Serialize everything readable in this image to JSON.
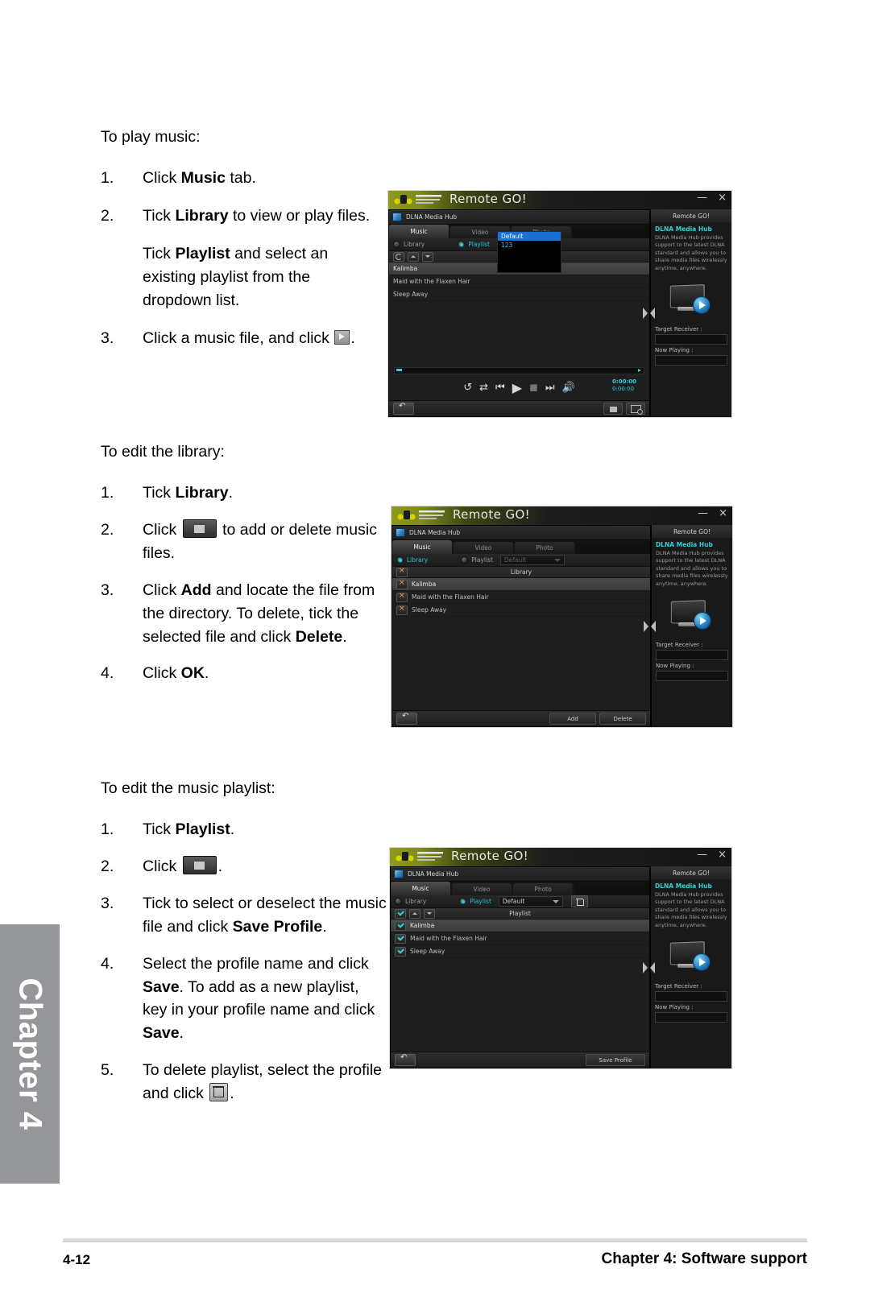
{
  "document": {
    "chapter_tab": "Chapter 4",
    "footer_page": "4-12",
    "footer_title": "Chapter 4: Software support"
  },
  "sections": [
    {
      "heading": "To play music:",
      "steps": [
        {
          "num": "1.",
          "text_pre": "Click ",
          "bold": "Music",
          "text_post": " tab."
        },
        {
          "num": "2.",
          "text_pre": "Tick ",
          "bold": "Library",
          "text_post": " to view or play files."
        },
        {
          "num": "",
          "text_pre": "Tick ",
          "bold": "Playlist",
          "text_post": " and select an existing playlist from the dropdown list."
        },
        {
          "num": "3.",
          "text_pre": "Click a music file, and click ",
          "bold": "",
          "text_post": "."
        }
      ]
    },
    {
      "heading": "To edit the library:",
      "steps": [
        {
          "num": "1.",
          "text_pre": "Tick ",
          "bold": "Library",
          "text_post": "."
        },
        {
          "num": "2.",
          "text_pre": "Click ",
          "bold": "",
          "text_post": " to add or delete music files."
        },
        {
          "num": "3.",
          "text_pre": "Click ",
          "bold": "Add",
          "text_post": " and locate the file from the directory. To delete, tick the selected file and click ",
          "bold2": "Delete",
          "text_end": "."
        },
        {
          "num": "4.",
          "text_pre": "Click ",
          "bold": "OK",
          "text_post": "."
        }
      ]
    },
    {
      "heading": "To edit the music playlist:",
      "steps": [
        {
          "num": "1.",
          "text_pre": "Tick ",
          "bold": "Playlist",
          "text_post": "."
        },
        {
          "num": "2.",
          "text_pre": "Click ",
          "bold": "",
          "text_post": "."
        },
        {
          "num": "3.",
          "text_pre": "Tick to select or deselect the music file and click ",
          "bold": "Save Profile",
          "text_post": "."
        },
        {
          "num": "4.",
          "text_pre": "Select the profile name and click ",
          "bold": "Save",
          "text_post": ". To add as a new playlist, key in your profile name and click ",
          "bold2": "Save",
          "text_end": "."
        },
        {
          "num": "5.",
          "text_pre": "To delete playlist, select the profile and click ",
          "bold": "",
          "text_post": "."
        }
      ]
    }
  ],
  "app": {
    "title": "Remote GO!",
    "hub_label": "DLNA Media Hub",
    "tabs": [
      "Music",
      "Video",
      "Photo"
    ],
    "radio_library": "Library",
    "radio_playlist": "Playlist",
    "combo_value": "Default",
    "dropdown_options": [
      "Default",
      "123"
    ],
    "tracks": [
      "Kalimba",
      "Maid with the Flaxen Hair",
      "Sleep Away"
    ],
    "list_header_library": "Library",
    "list_header_playlist": "Playlist",
    "time_current": "0:00:00",
    "time_total": "0:00:00",
    "buttons": {
      "add": "Add",
      "delete": "Delete",
      "save_profile": "Save Profile"
    },
    "right_pane": {
      "title": "Remote GO!",
      "heading": "DLNA Media Hub",
      "body": "DLNA Media Hub provides support to the latest DLNA standard and allows you to share media files wirelessly anytime, anywhere.",
      "target_receiver": "Target Receiver :",
      "now_playing": "Now Playing :"
    },
    "window_buttons": {
      "minimize": "—",
      "close": "×"
    },
    "colors": {
      "accent_cyan": "#2fd0e0",
      "title_green": "#8e9b1e",
      "select_blue": "#1a6fd4",
      "check_orange": "#e9a93a"
    }
  }
}
